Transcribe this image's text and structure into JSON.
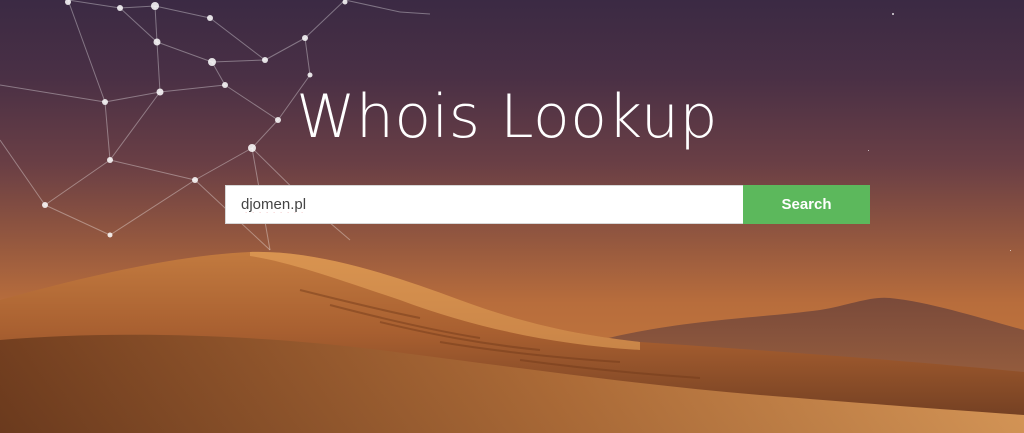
{
  "page": {
    "title": "Whois Lookup"
  },
  "search": {
    "value": "djomen.pl",
    "button_label": "Search"
  },
  "colors": {
    "button": "#5cb85c",
    "sky_top": "#3b2a44",
    "sand": "#c87d3e"
  }
}
